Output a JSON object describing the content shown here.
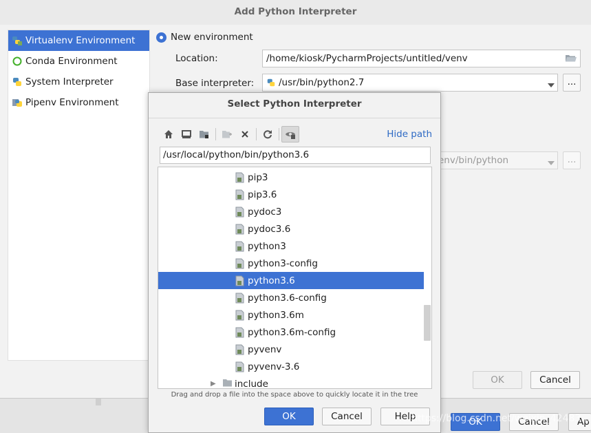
{
  "window": {
    "title": "Add Python Interpreter"
  },
  "sidebar": {
    "items": [
      {
        "label": "Virtualenv Environment",
        "icon": "virtualenv-icon"
      },
      {
        "label": "Conda Environment",
        "icon": "conda-icon"
      },
      {
        "label": "System Interpreter",
        "icon": "python-icon"
      },
      {
        "label": "Pipenv Environment",
        "icon": "pipenv-icon"
      }
    ],
    "selected": "Virtualenv Environment"
  },
  "form": {
    "new_env_label": "New environment",
    "location_label": "Location:",
    "location_value": "/home/kiosk/PycharmProjects/untitled/venv",
    "base_interp_label": "Base interpreter:",
    "base_interp_value": "/usr/bin/python2.7",
    "existing_interp_value": "env/bin/python",
    "browse_label": "..."
  },
  "buttons": {
    "ok": "OK",
    "cancel": "Cancel",
    "bottom_ok": "OK",
    "bottom_cancel": "Cancel",
    "bottom_apply": "Ap"
  },
  "dialog": {
    "title": "Select Python Interpreter",
    "hide_path": "Hide path",
    "path": "/usr/local/python/bin/python3.6",
    "files": [
      "pip3",
      "pip3.6",
      "pydoc3",
      "pydoc3.6",
      "python3",
      "python3-config",
      "python3.6",
      "python3.6-config",
      "python3.6m",
      "python3.6m-config",
      "pyvenv",
      "pyvenv-3.6"
    ],
    "selected_file": "python3.6",
    "folder": "include",
    "hint": "Drag and drop a file into the space above to quickly locate it in the tree",
    "ok": "OK",
    "cancel": "Cancel",
    "help": "Help"
  },
  "watermark": "https://blog.csdn.net/weixin_42483..."
}
